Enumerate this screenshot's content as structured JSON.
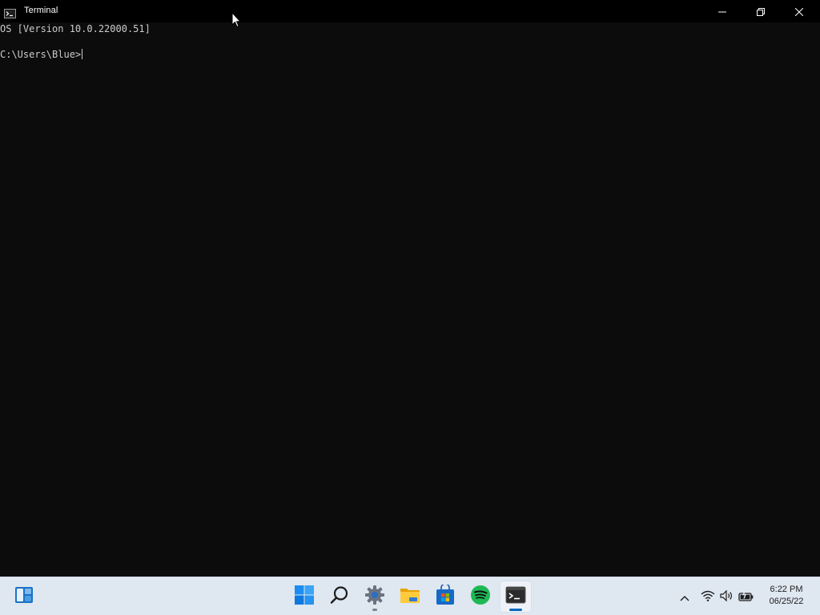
{
  "window": {
    "title": "Terminal",
    "title_icon": "terminal-icon",
    "controls": {
      "minimize_icon": "minimize-icon",
      "maximize_icon": "restore-icon",
      "close_icon": "close-icon"
    }
  },
  "console": {
    "lines": [
      "OS [Version 10.0.22000.51]",
      "",
      "C:\\Users\\Blue>"
    ],
    "background": "#0c0c0c",
    "foreground": "#cccccc"
  },
  "taskbar": {
    "background": "#dfe7f1",
    "left_widget_icon": "widgets-icon",
    "apps": [
      {
        "icon": "windows-start-icon",
        "state": "none"
      },
      {
        "icon": "search-icon",
        "state": "none"
      },
      {
        "icon": "settings-gear-icon",
        "state": "running"
      },
      {
        "icon": "file-explorer-icon",
        "state": "none"
      },
      {
        "icon": "microsoft-store-icon",
        "state": "none"
      },
      {
        "icon": "spotify-icon",
        "state": "none"
      },
      {
        "icon": "terminal-icon",
        "state": "active"
      }
    ],
    "tray": {
      "icons": [
        "chevron-up-icon",
        "wifi-icon",
        "volume-icon",
        "battery-charging-icon"
      ],
      "time": "6:22 PM",
      "date": "06/25/22"
    },
    "accent": "#0067c0"
  }
}
